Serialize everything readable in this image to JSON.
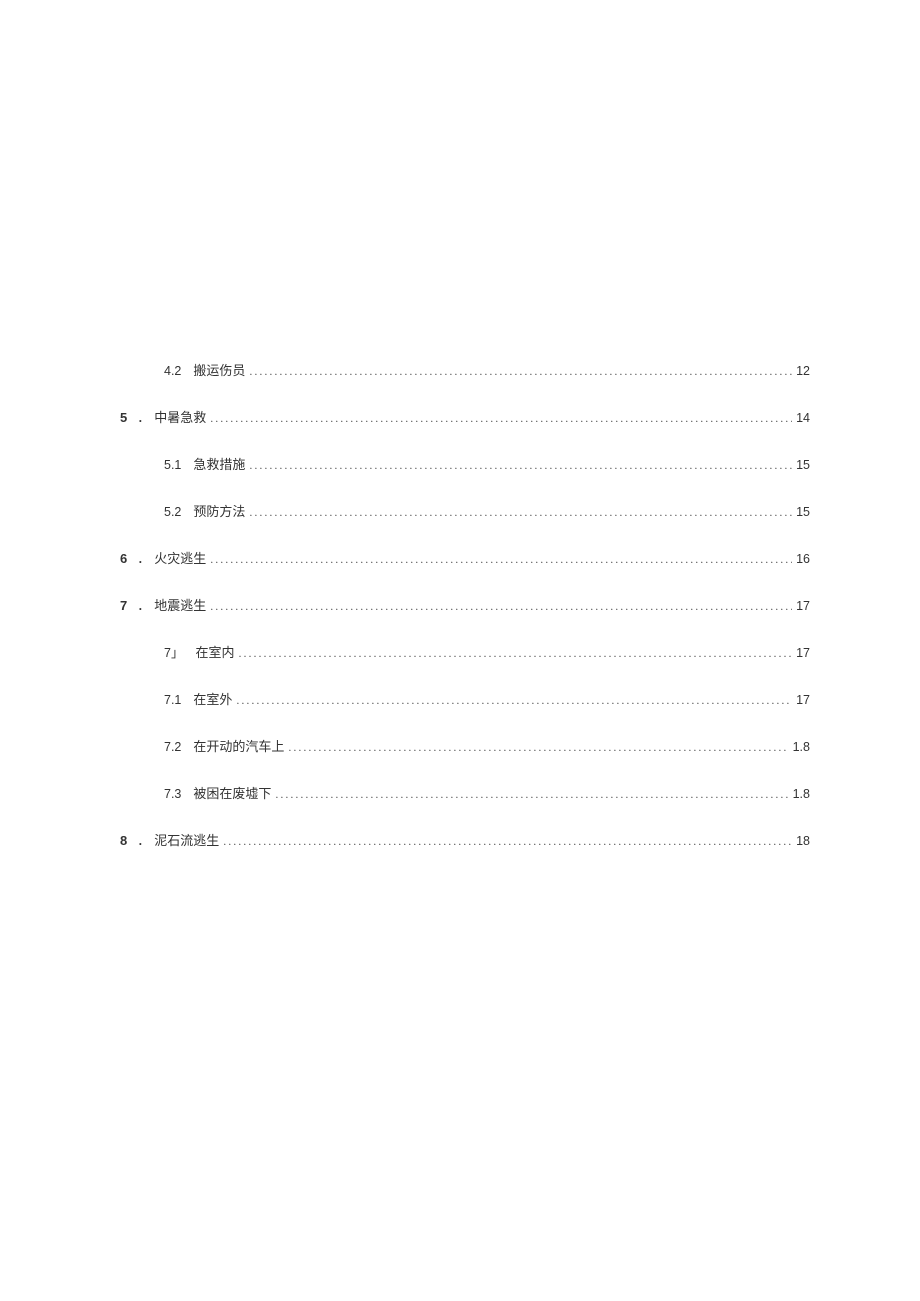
{
  "toc": [
    {
      "level": 2,
      "number": "4.2",
      "title": "搬运伤员",
      "page": "12",
      "sep": ""
    },
    {
      "level": 1,
      "number": "5",
      "title": "中暑急救",
      "page": "14",
      "sep": "．"
    },
    {
      "level": 2,
      "number": "5.1",
      "title": "急救措施",
      "page": "15",
      "sep": ""
    },
    {
      "level": 2,
      "number": "5.2",
      "title": "预防方法",
      "page": "15",
      "sep": ""
    },
    {
      "level": 1,
      "number": "6",
      "title": "火灾逃生",
      "page": "16",
      "sep": "．"
    },
    {
      "level": 1,
      "number": "7",
      "title": "地震逃生",
      "page": "17",
      "sep": "．"
    },
    {
      "level": 2,
      "number": "7」",
      "title": "在室内",
      "page": "17",
      "sep": ""
    },
    {
      "level": 2,
      "number": "7.1",
      "title": "在室外",
      "page": "17",
      "sep": ""
    },
    {
      "level": 2,
      "number": "7.2",
      "title": "在开动的汽车上",
      "page": "1.8",
      "sep": ""
    },
    {
      "level": 2,
      "number": "7.3",
      "title": "被困在废墟下",
      "page": "1.8",
      "sep": ""
    },
    {
      "level": 1,
      "number": "8",
      "title": "泥石流逃生",
      "page": "18",
      "sep": "．"
    }
  ]
}
